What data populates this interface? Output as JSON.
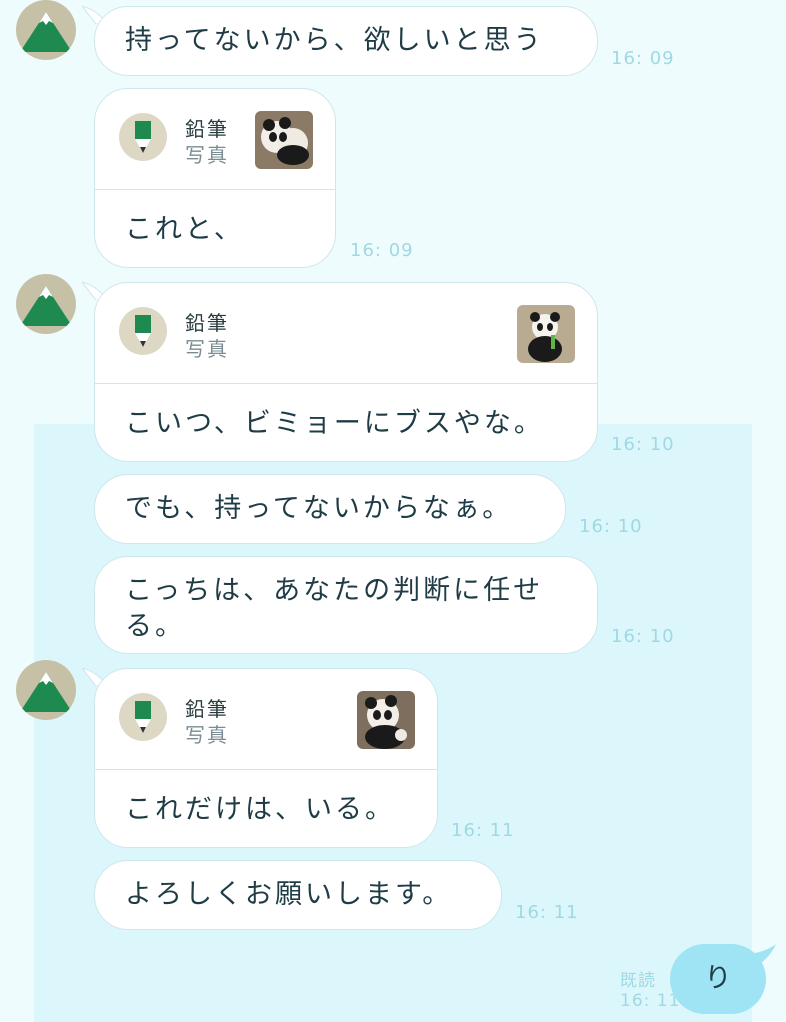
{
  "colors": {
    "background": "#eefcfd",
    "panel": "#dcf7fb",
    "bubble": "#ffffff",
    "sent_bubble": "#9ee4f4",
    "time": "#9ed9e4",
    "avatar_green": "#1f8a4f"
  },
  "messages": [
    {
      "type": "text",
      "text": "持ってないから、欲しいと思う",
      "time": "16: 09"
    },
    {
      "type": "card",
      "sender": "鉛筆",
      "kind": "写真",
      "text": "これと、",
      "time": "16: 09"
    },
    {
      "type": "card",
      "sender": "鉛筆",
      "kind": "写真",
      "text": "こいつ、ビミョーにブスやな。",
      "time": "16: 10"
    },
    {
      "type": "text",
      "text": "でも、持ってないからなぁ。",
      "time": "16: 10"
    },
    {
      "type": "text",
      "line1": "こっちは、あなたの判断に任せ",
      "line2": "る。",
      "time": "16: 10"
    },
    {
      "type": "card",
      "sender": "鉛筆",
      "kind": "写真",
      "text": "これだけは、いる。",
      "time": "16: 11"
    },
    {
      "type": "text",
      "text": "よろしくお願いします。",
      "time": "16: 11"
    }
  ],
  "sent": {
    "text": "り",
    "read_label": "既読",
    "time": "16: 11"
  }
}
